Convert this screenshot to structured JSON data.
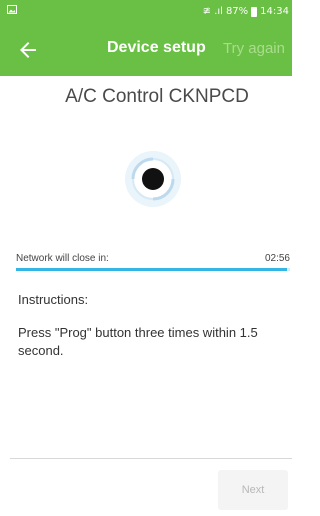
{
  "status_bar": {
    "left_icon": "gallery-icon",
    "indicators": "≇ .ıl",
    "battery": "87%",
    "time": "14:34"
  },
  "app_bar": {
    "back_icon": "arrow-left-icon",
    "title": "Device setup",
    "action": "Try again"
  },
  "device": {
    "name": "A/C Control CKNPCD",
    "icon": "device-target-icon"
  },
  "network": {
    "label": "Network will close in:",
    "countdown": "02:56",
    "progress": 0.99
  },
  "instructions": {
    "heading": "Instructions:",
    "text": "Press \"Prog\" button three times within 1.5 second."
  },
  "footer": {
    "next_label": "Next"
  },
  "colors": {
    "primary": "#6abf45",
    "progress": "#33b5e5",
    "disabled_text": "#b8b8b8"
  }
}
